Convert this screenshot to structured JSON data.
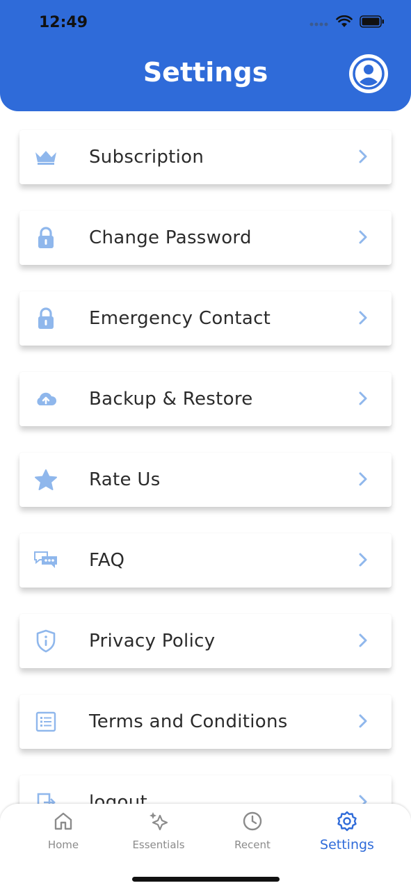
{
  "status_bar": {
    "time": "12:49"
  },
  "header": {
    "title": "Settings"
  },
  "colors": {
    "accent": "#2f6bd9",
    "icon": "#8fb7ec"
  },
  "settings_items": [
    {
      "label": "Subscription",
      "icon": "crown-icon"
    },
    {
      "label": "Change Password",
      "icon": "lock-icon"
    },
    {
      "label": "Emergency Contact",
      "icon": "lock-icon"
    },
    {
      "label": "Backup & Restore",
      "icon": "cloud-upload-icon"
    },
    {
      "label": "Rate Us",
      "icon": "star-icon"
    },
    {
      "label": "FAQ",
      "icon": "chat-bubbles-icon"
    },
    {
      "label": "Privacy Policy",
      "icon": "shield-info-icon"
    },
    {
      "label": "Terms and Conditions",
      "icon": "list-icon"
    },
    {
      "label": "logout",
      "icon": "logout-icon"
    }
  ],
  "tabs": [
    {
      "label": "Home",
      "icon": "home-icon",
      "active": false
    },
    {
      "label": "Essentials",
      "icon": "sparkle-icon",
      "active": false
    },
    {
      "label": "Recent",
      "icon": "clock-icon",
      "active": false
    },
    {
      "label": "Settings",
      "icon": "gear-icon",
      "active": true
    }
  ]
}
